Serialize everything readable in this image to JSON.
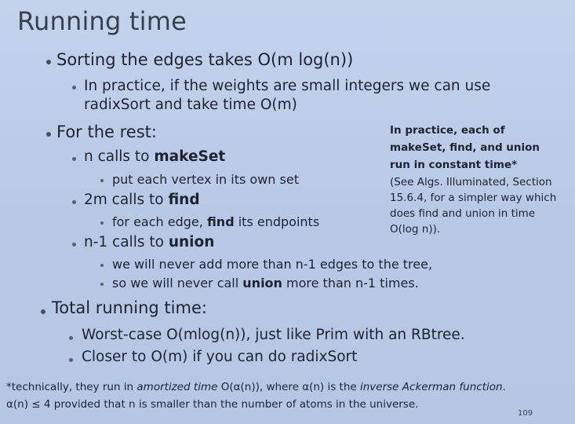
{
  "title": "Running time",
  "bullets": {
    "sorting": "Sorting the edges takes O(m log(n))",
    "practice_1": "In practice, if the weights are small integers we can use",
    "practice_2": "radixSort and take time O(m)",
    "rest": "For the rest:",
    "makeset_pre": "n calls to ",
    "makeset_kw": "makeSet",
    "makeset_sub": "put each vertex in its own set",
    "find_pre": "2m calls to ",
    "find_kw": "find",
    "find_sub_pre": "for each edge, ",
    "find_sub_kw": "find",
    "find_sub_post": " its endpoints",
    "union_pre": "n-1 calls to ",
    "union_kw": "union",
    "union_sub1": "we will never add more than n-1 edges to the tree,",
    "union_sub2_pre": "so we will never call ",
    "union_sub2_kw": "union",
    "union_sub2_post": " more than n-1 times.",
    "total": "Total running time:",
    "worst": "Worst-case O(mlog(n)), just like Prim with an RBtree.",
    "closer": "Closer to O(m) if you can do radixSort"
  },
  "sidenote": {
    "bold_1": "In practice, each of",
    "bold_2": "makeSet, find, and union",
    "bold_3": "run in constant time*",
    "normal_1": "(See Algs. Illuminated, Section",
    "normal_2": "15.6.4, for a simpler way which",
    "normal_3": "does find and union in time",
    "normal_4": "O(log n))."
  },
  "footnote": {
    "line1_a": "*technically, they run in ",
    "line1_b": "amortized time",
    "line1_c": " O(α(n)), where α(n) is the ",
    "line1_d": "inverse Ackerman function",
    "line1_e": ".",
    "line2": "α(n) ≤ 4 provided that n is smaller than the number of atoms in the universe."
  },
  "page_number": "109"
}
